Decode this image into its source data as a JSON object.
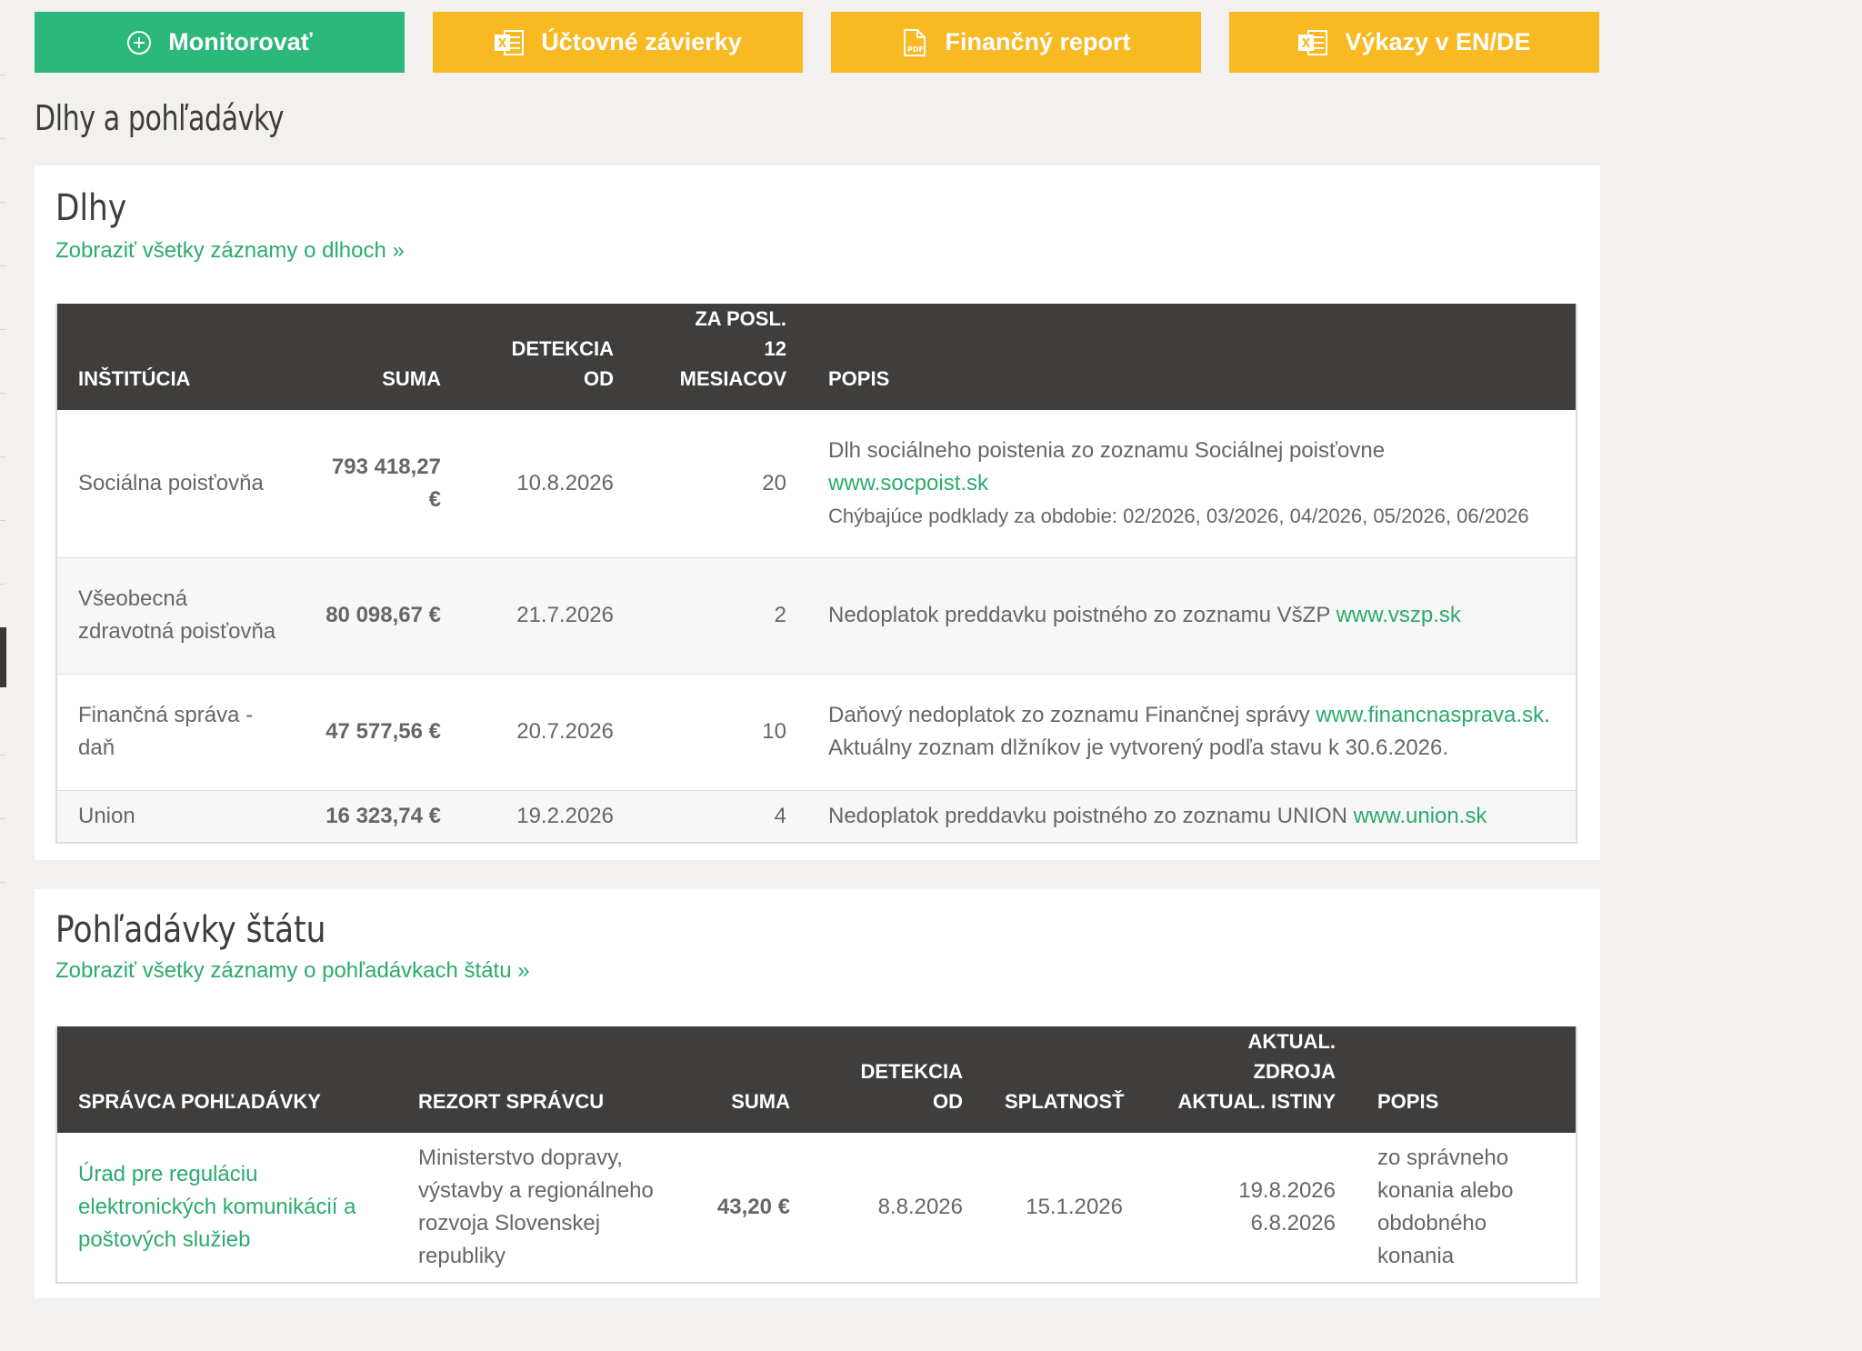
{
  "toolbar": {
    "monitor_label": "Monitorovať",
    "statements_label": "Účtovné závierky",
    "report_label": "Finančný report",
    "en_de_label": "Výkazy v EN/DE"
  },
  "page_title": "Dlhy a pohľadávky",
  "debts": {
    "title": "Dlhy",
    "more_link": "Zobraziť všetky záznamy o dlhoch »",
    "headers": {
      "institution": "INŠTITÚCIA",
      "amount": "SUMA",
      "detected": "DETEKCIA OD",
      "last12_line1": "ZA POSL.",
      "last12_line2": "12 MESIACOV",
      "description": "POPIS"
    },
    "rows": [
      {
        "institution": "Sociálna poisťovňa",
        "amount": "793 418,27 €",
        "detected": "10.8.2026",
        "last12": "20",
        "desc_text": "Dlh sociálneho poistenia zo zoznamu Sociálnej poisťovne",
        "desc_link": "www.socpoist.sk",
        "desc_extra": "Chýbajúce podklady za obdobie: 02/2026, 03/2026, 04/2026, 05/2026, 06/2026"
      },
      {
        "institution": "Všeobecná zdravotná poisťovňa",
        "amount": "80 098,67 €",
        "detected": "21.7.2026",
        "last12": "2",
        "desc_text": "Nedoplatok preddavku poistného zo zoznamu VšZP",
        "desc_link": "www.vszp.sk"
      },
      {
        "institution": "Finančná správa - daň",
        "amount": "47 577,56 €",
        "detected": "20.7.2026",
        "last12": "10",
        "desc_text": "Daňový nedoplatok zo zoznamu Finančnej správy",
        "desc_link": "www.financnasprava.sk",
        "desc_after": ". Aktuálny zoznam dlžníkov je vytvorený podľa stavu k 30.6.2026."
      },
      {
        "institution": "Union",
        "amount": "16 323,74 €",
        "detected": "19.2.2026",
        "last12": "4",
        "desc_text": "Nedoplatok preddavku poistného zo zoznamu UNION",
        "desc_link": "www.union.sk"
      }
    ]
  },
  "claims": {
    "title": "Pohľadávky štátu",
    "more_link": "Zobraziť všetky záznamy o pohľadávkach štátu »",
    "headers": {
      "administrator": "SPRÁVCA POHĽADÁVKY",
      "ministry": "REZORT SPRÁVCU",
      "amount": "SUMA",
      "detected": "DETEKCIA OD",
      "due": "SPLATNOSŤ",
      "update_line1": "AKTUAL. ZDROJA",
      "update_line2": "AKTUAL. ISTINY",
      "description": "POPIS"
    },
    "rows": [
      {
        "administrator": "Úrad pre reguláciu elektronických komunikácií a poštových služieb",
        "ministry": "Ministerstvo dopravy, výstavby a regionálneho rozvoja Slovenskej republiky",
        "amount": "43,20 €",
        "detected": "8.8.2026",
        "due": "15.1.2026",
        "update_source": "19.8.2026",
        "update_principal": "6.8.2026",
        "description": "zo správneho konania alebo obdobného konania"
      }
    ]
  },
  "colors": {
    "green": "#2bb87a",
    "yellow": "#f8b922",
    "header_dark": "#403e3c",
    "link_green": "#2bab6e"
  }
}
